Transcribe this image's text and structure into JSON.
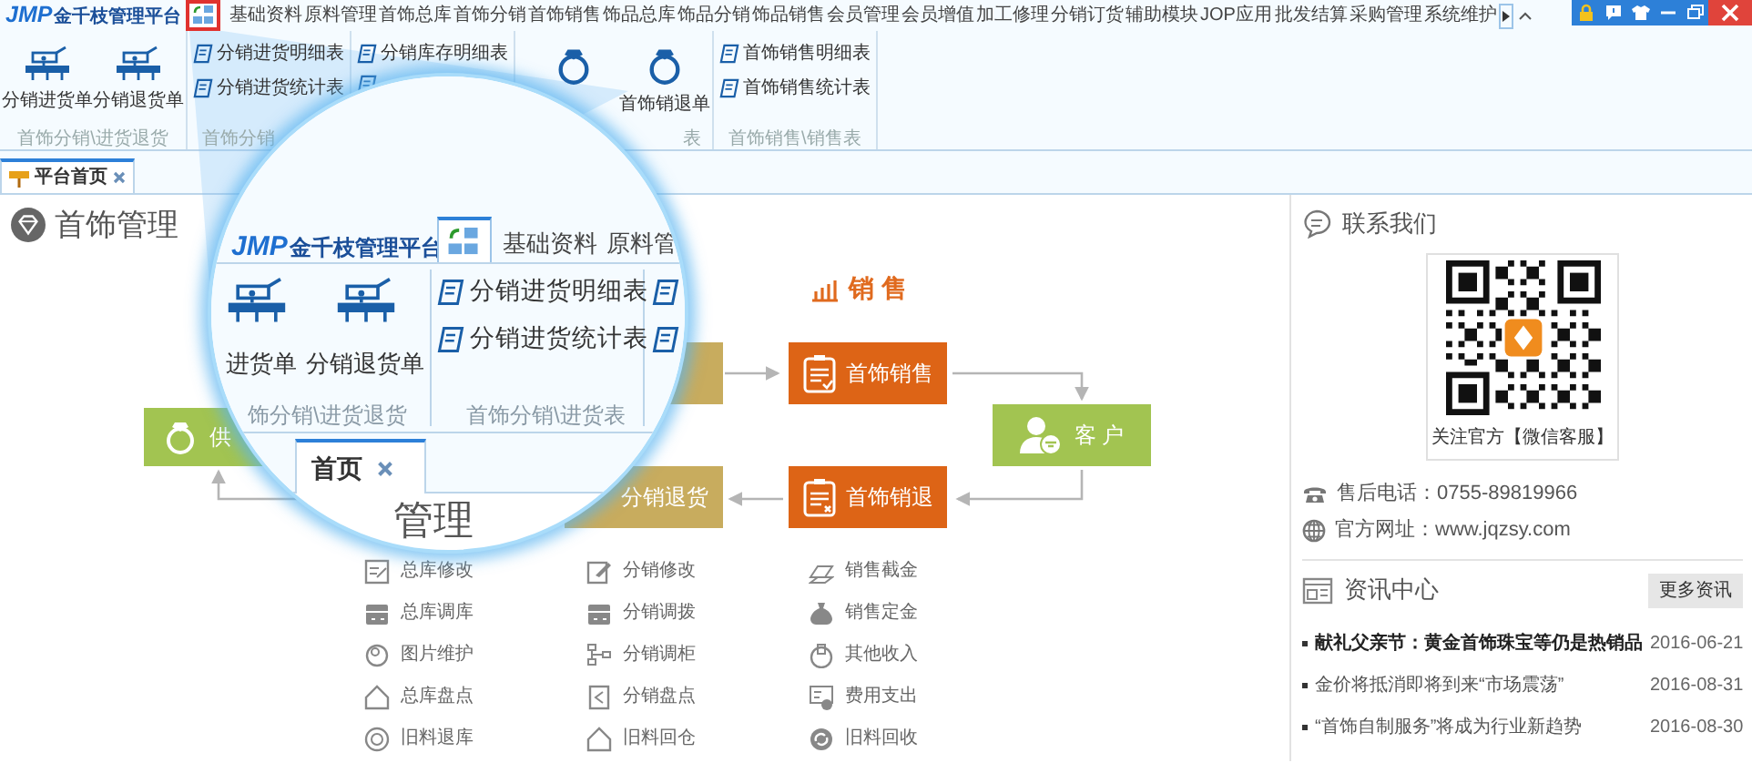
{
  "title_bar": {
    "logo_mark": "JMP",
    "logo_text": "金千枝管理平台",
    "menu": [
      "基础资料",
      "原料管理",
      "首饰总库",
      "首饰分销",
      "首饰销售",
      "饰品总库",
      "饰品分销",
      "饰品销售",
      "会员管理",
      "会员增值",
      "加工修理",
      "分销订货",
      "辅助模块",
      "JOP应用",
      "批发结算",
      "采购管理",
      "系统维护"
    ]
  },
  "ribbon": {
    "groups": [
      {
        "kind": "large",
        "label": "首饰分销\\进货退货",
        "items": [
          {
            "label": "分销进货单",
            "covered": false
          },
          {
            "label": "分销退货单",
            "covered": false
          }
        ]
      },
      {
        "kind": "list",
        "label": "首饰分销",
        "items": [
          {
            "label": "分销进货明细表",
            "covered": false
          },
          {
            "label": "分销进货统计表",
            "covered": false
          }
        ]
      },
      {
        "kind": "list",
        "items": [
          {
            "label": "分销库存明细表",
            "covered": false
          },
          {
            "covered": true
          }
        ]
      },
      {
        "kind": "rings",
        "label": "表",
        "items": [
          {
            "covered": true
          },
          {
            "label": "首饰销退单",
            "covered": false
          }
        ]
      },
      {
        "kind": "list",
        "label": "首饰销售\\销售表",
        "items": [
          {
            "label": "首饰销售明细表",
            "covered": false
          },
          {
            "label": "首饰销售统计表",
            "covered": false
          }
        ]
      }
    ]
  },
  "tabs": [
    {
      "label": "平台首页",
      "selected": true
    }
  ],
  "main": {
    "heading": "首饰管理",
    "diagram": {
      "sales_title": "销 售",
      "nodes": [
        {
          "kind": "distribution",
          "color": "#c8ac5e"
        },
        {
          "kind": "sale",
          "label": "首饰销售",
          "color": "#dd6416"
        },
        {
          "kind": "customer",
          "label": "客 户",
          "color": "#a2c451"
        },
        {
          "kind": "sale-return",
          "label": "首饰销退",
          "color": "#dd6416"
        },
        {
          "kind": "distribution-return",
          "label": "分销退货",
          "color": "#c8ac5e"
        },
        {
          "kind": "supplier",
          "label": "供",
          "color": "#a2c451"
        }
      ]
    },
    "shortcuts": [
      [
        "总库修改",
        "总库调库",
        "图片维护",
        "总库盘点",
        "旧料退库"
      ],
      [
        "分销修改",
        "分销调拨",
        "分销调柜",
        "分销盘点",
        "旧料回仓"
      ],
      [
        "销售截金",
        "销售定金",
        "其他收入",
        "费用支出",
        "旧料回收"
      ]
    ]
  },
  "magnifier": {
    "logo_mark": "JMP",
    "logo_text": "金千枝管理平台",
    "menu": [
      "基础资料",
      "原料管"
    ],
    "large_buttons": [
      "进货单",
      "分销退货单"
    ],
    "reports": [
      "分销进货明细表",
      "分销进货统计表"
    ],
    "group_labels": [
      "饰分销\\进货退货",
      "首饰分销\\进货表"
    ],
    "tab": "首页",
    "heading": "管理"
  },
  "contact": {
    "title": "联系我们",
    "qr_caption": "关注官方【微信客服】",
    "phone": "售后电话：0755-89819966",
    "website": "官方网址：www.jqzsy.com"
  },
  "news": {
    "title": "资讯中心",
    "more_button": "更多资讯",
    "items": [
      {
        "title": "献礼父亲节：黄金首饰珠宝等仍是热销品",
        "date": "2016-06-21",
        "highlighted": true
      },
      {
        "title": "金价将抵消即将到来“市场震荡”",
        "date": "2016-08-31",
        "highlighted": false
      },
      {
        "title": "“首饰自制服务”将成为行业新趋势",
        "date": "2016-08-30",
        "highlighted": false
      }
    ]
  }
}
